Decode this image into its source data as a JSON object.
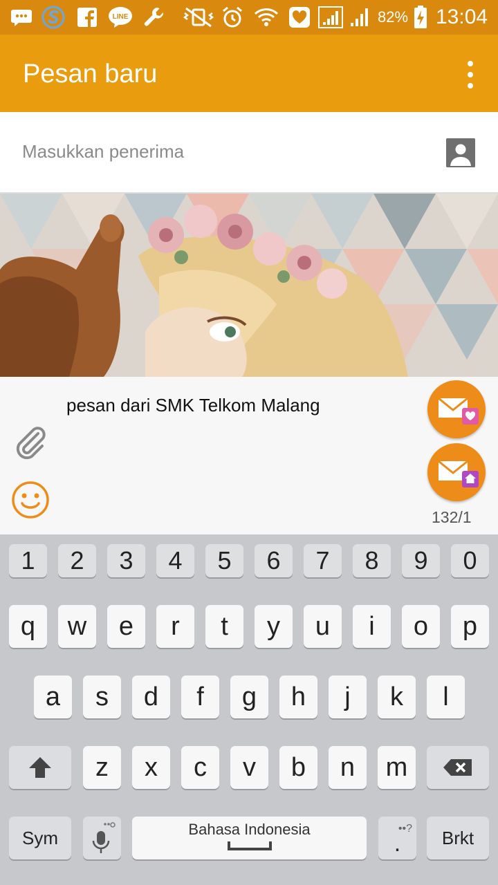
{
  "status_bar": {
    "battery_percent": "82%",
    "time": "13:04",
    "icons": [
      "bbm-icon",
      "s-browser-icon",
      "facebook-icon",
      "line-icon",
      "wrench-icon",
      "mute-icon",
      "alarm-icon",
      "wifi-icon",
      "heart-app-icon",
      "signal-icon",
      "signal-icon-2",
      "charging-icon"
    ]
  },
  "action_bar": {
    "title": "Pesan baru",
    "menu_icon": "overflow-menu-icon"
  },
  "recipient": {
    "placeholder": "Masukkan penerima",
    "contact_icon": "contact-icon"
  },
  "compose": {
    "message_text": "pesan dari SMK Telkom Malang",
    "attach_icon": "paperclip-icon",
    "emoji_icon": "smiley-icon",
    "send_buttons": [
      "send-message-icon",
      "send-message-icon"
    ],
    "counter": "132/1"
  },
  "keyboard": {
    "row_numbers": [
      "1",
      "2",
      "3",
      "4",
      "5",
      "6",
      "7",
      "8",
      "9",
      "0"
    ],
    "row1": [
      "q",
      "w",
      "e",
      "r",
      "t",
      "y",
      "u",
      "i",
      "o",
      "p"
    ],
    "row2": [
      "a",
      "s",
      "d",
      "f",
      "g",
      "h",
      "j",
      "k",
      "l"
    ],
    "row3": [
      "z",
      "x",
      "c",
      "v",
      "b",
      "n",
      "m"
    ],
    "sym_label": "Sym",
    "space_label": "Bahasa Indonesia",
    "enter_label": "Brkt",
    "punct_top": "••?",
    "punct_main": ".",
    "colors": {
      "keyboard_bg": "#c6c8cc",
      "key_bg": "#f7f7f7",
      "accent": "#e99d0e"
    }
  }
}
